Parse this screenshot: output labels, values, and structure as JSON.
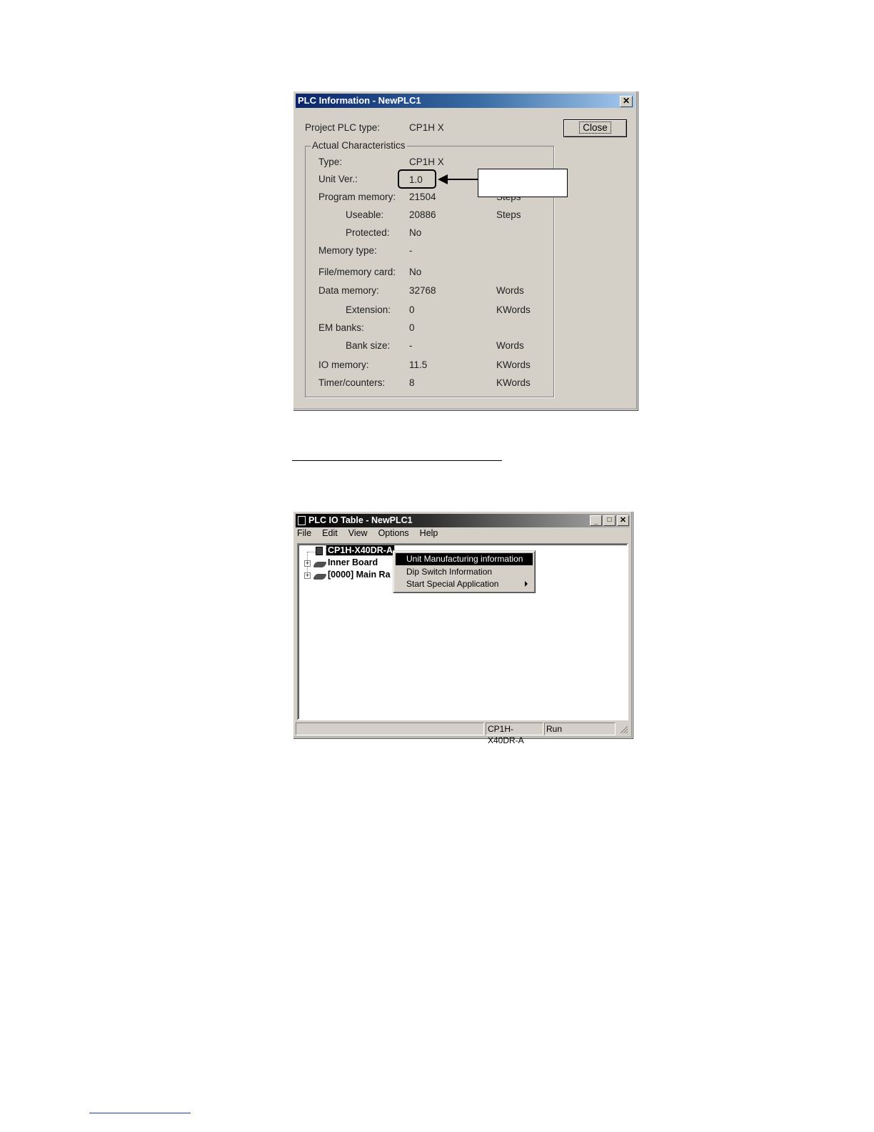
{
  "plc_info_dialog": {
    "title": "PLC Information - NewPLC1",
    "close_button": "Close",
    "project_plc_type_label": "Project PLC type:",
    "project_plc_type_value": "CP1H X",
    "group_label": "Actual Characteristics",
    "rows": {
      "type": {
        "label": "Type:",
        "value": "CP1H X",
        "unit": ""
      },
      "unit_ver": {
        "label": "Unit Ver.:",
        "value": "1.0",
        "unit": ""
      },
      "program_memory": {
        "label": "Program memory:",
        "value": "21504",
        "unit": "Steps"
      },
      "useable": {
        "label": "Useable:",
        "value": "20886",
        "unit": "Steps"
      },
      "protected": {
        "label": "Protected:",
        "value": "No",
        "unit": ""
      },
      "memory_type": {
        "label": "Memory type:",
        "value": "-",
        "unit": ""
      },
      "file_memory_card": {
        "label": "File/memory card:",
        "value": "No",
        "unit": ""
      },
      "data_memory": {
        "label": "Data memory:",
        "value": "32768",
        "unit": "Words"
      },
      "extension": {
        "label": "Extension:",
        "value": "0",
        "unit": "KWords"
      },
      "em_banks": {
        "label": "EM banks:",
        "value": "0",
        "unit": ""
      },
      "bank_size": {
        "label": "Bank size:",
        "value": "-",
        "unit": "Words"
      },
      "io_memory": {
        "label": "IO memory:",
        "value": "11.5",
        "unit": "KWords"
      },
      "timer_counters": {
        "label": "Timer/counters:",
        "value": "8",
        "unit": "KWords"
      }
    }
  },
  "io_table_window": {
    "title": "PLC IO Table - NewPLC1",
    "menu": [
      "File",
      "Edit",
      "View",
      "Options",
      "Help"
    ],
    "tree": {
      "root": "CP1H-X40DR-A",
      "children": [
        "Inner Board",
        "[0000] Main Ra"
      ]
    },
    "context_menu": {
      "items": [
        "Unit Manufacturing information",
        "Dip Switch Information",
        "Start Special Application"
      ]
    },
    "status_bar": {
      "model": "CP1H-X40DR-A",
      "mode": "Run"
    }
  }
}
